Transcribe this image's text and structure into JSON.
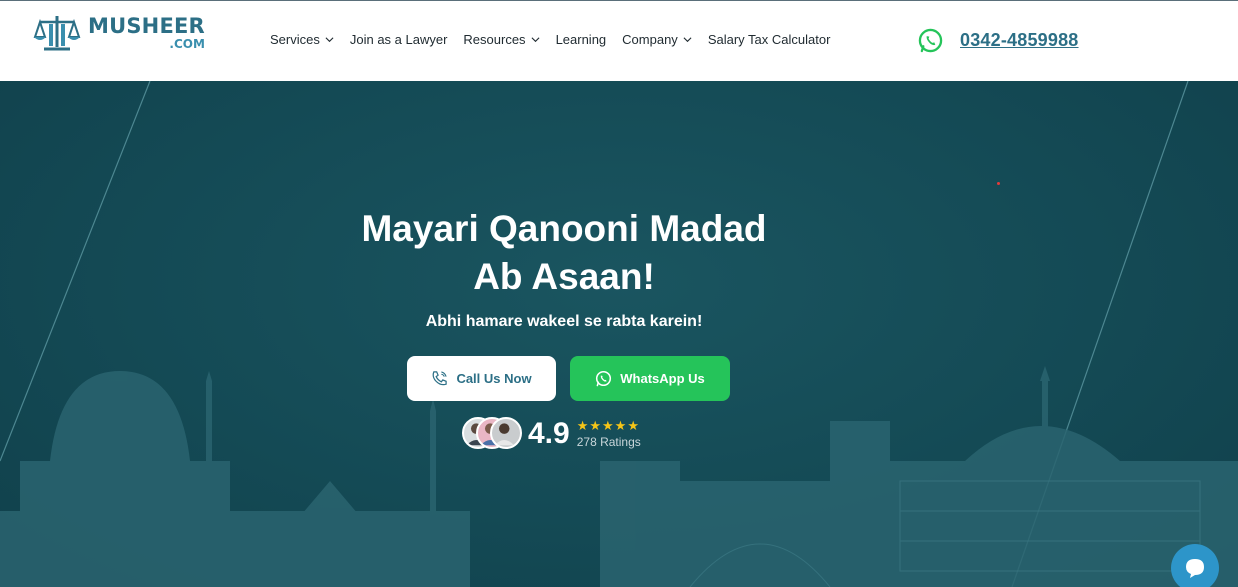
{
  "brand": {
    "name": "MUSHEER",
    "domain": ".COM",
    "color": "#2c6f86"
  },
  "nav": {
    "items": [
      {
        "label": "Services",
        "has_dropdown": true
      },
      {
        "label": "Join as a Lawyer",
        "has_dropdown": false
      },
      {
        "label": "Resources",
        "has_dropdown": true
      },
      {
        "label": "Learning",
        "has_dropdown": false
      },
      {
        "label": "Company",
        "has_dropdown": true
      },
      {
        "label": "Salary Tax Calculator",
        "has_dropdown": false
      }
    ]
  },
  "contact": {
    "phone": "0342-4859988",
    "icon": "whatsapp-icon"
  },
  "hero": {
    "title_line1": "Mayari Qanooni Madad",
    "title_line2": "Ab Asaan!",
    "subtitle": "Abhi hamare wakeel se rabta karein!",
    "call_button": "Call Us Now",
    "whatsapp_button": "WhatsApp Us",
    "rating_value": "4.9",
    "stars": "★★★★★",
    "rating_count": "278 Ratings",
    "background_color": "#144a55"
  },
  "colors": {
    "whatsapp_green": "#25c45a",
    "star": "#f5c518",
    "chat": "#2d95c9"
  }
}
